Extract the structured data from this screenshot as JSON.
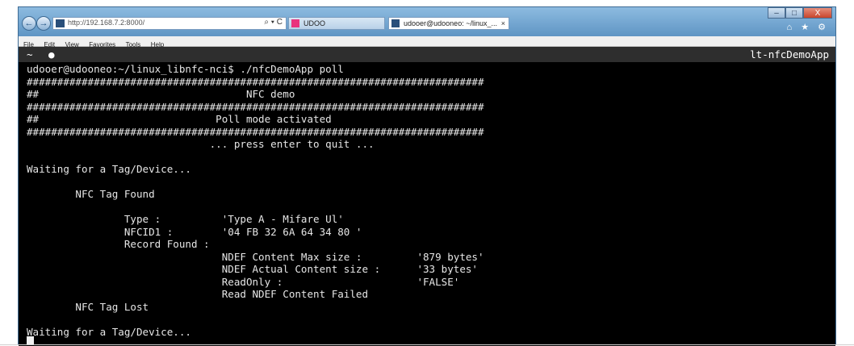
{
  "browser": {
    "address_url": "http://192.168.7.2:8000/",
    "address_controls": "⌕ ▾ C",
    "tabs": [
      {
        "label": "UDOO",
        "icon": "udoo-favicon"
      },
      {
        "label": "udooer@udooneo: ~/linux_...",
        "close": "×",
        "icon": "terminal-favicon"
      }
    ],
    "window_controls": {
      "minimize": "–",
      "maximize": "□",
      "close": "X"
    },
    "toolbar_icons": "⌂ ★ ⚙",
    "menu": [
      "File",
      "Edit",
      "View",
      "Favorites",
      "Tools",
      "Help"
    ]
  },
  "terminal": {
    "left_glyphs": "~ ●",
    "title": "lt-nfcDemoApp",
    "output": "udooer@udooneo:~/linux_libnfc-nci$ ./nfcDemoApp poll\n###########################################################################\n##                                  NFC demo\n###########################################################################\n##                             Poll mode activated\n###########################################################################\n                              ... press enter to quit ...\n\nWaiting for a Tag/Device...\n\n        NFC Tag Found\n\n                Type :          'Type A - Mifare Ul'\n                NFCID1 :        '04 FB 32 6A 64 34 80 '\n                Record Found :\n                                NDEF Content Max size :         '879 bytes'\n                                NDEF Actual Content size :      '33 bytes'\n                                ReadOnly :                      'FALSE'\n                                Read NDEF Content Failed\n        NFC Tag Lost\n\nWaiting for a Tag/Device..."
  }
}
